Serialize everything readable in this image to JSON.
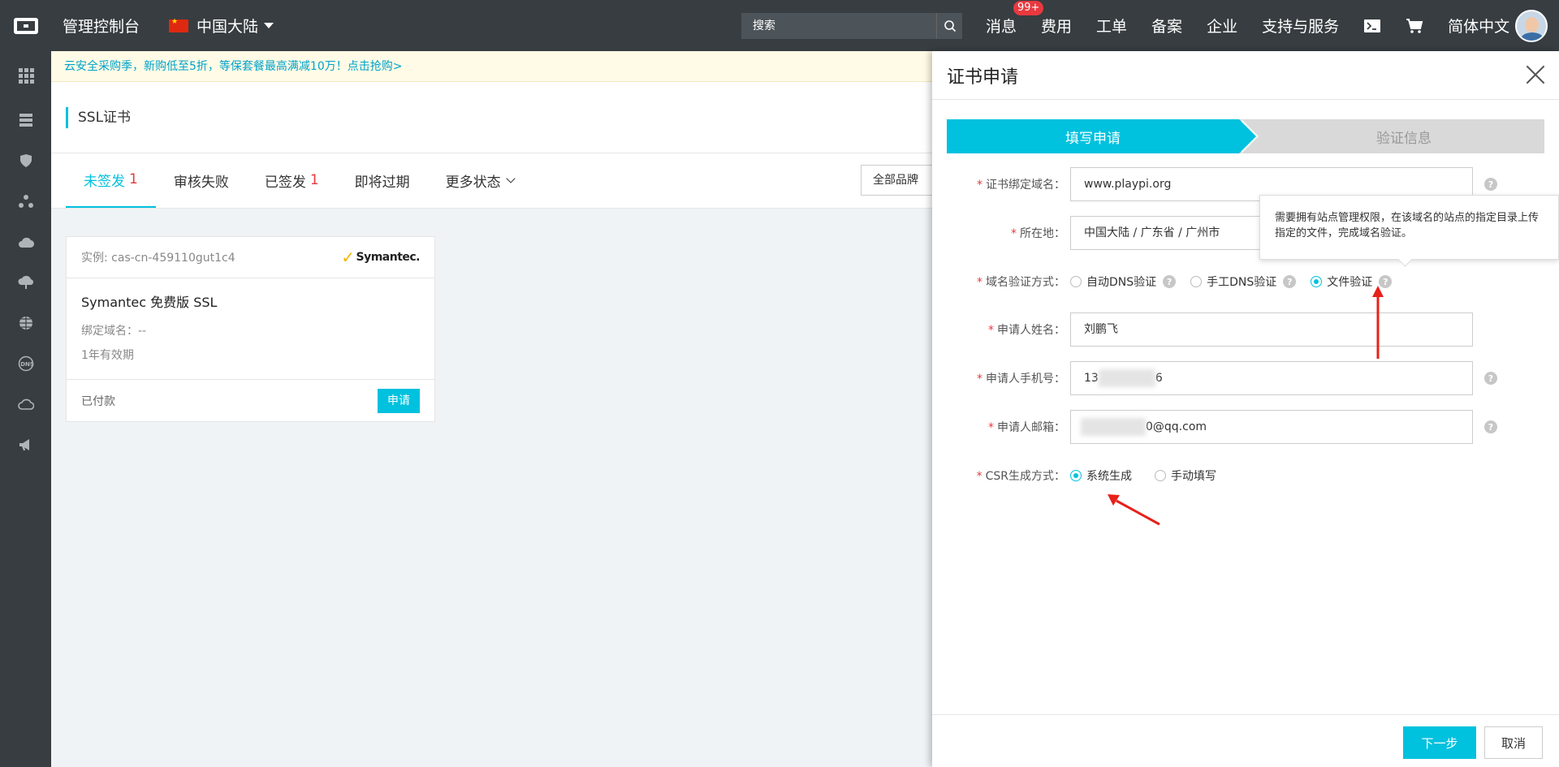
{
  "topbar": {
    "console_title": "管理控制台",
    "region": "中国大陆",
    "search_placeholder": "搜索",
    "nav": {
      "messages": "消息",
      "messages_badge": "99+",
      "billing": "费用",
      "tickets": "工单",
      "icp": "备案",
      "enterprise": "企业",
      "support": "支持与服务",
      "language": "简体中文"
    }
  },
  "promo": "云安全采购季，新购低至5折，等保套餐最高满减10万！点击抢购>",
  "page": {
    "title": "SSL证书",
    "tabs": [
      {
        "label": "未签发",
        "count": "1"
      },
      {
        "label": "审核失败",
        "count": ""
      },
      {
        "label": "已签发",
        "count": "1"
      },
      {
        "label": "即将过期",
        "count": ""
      },
      {
        "label": "更多状态",
        "count": ""
      }
    ],
    "brand_filter": "全部品牌"
  },
  "card": {
    "instance": "实例: cas-cn-459110gut1c4",
    "brand": "Symantec.",
    "name": "Symantec 免费版 SSL",
    "domain": "绑定域名：--",
    "validity": "1年有效期",
    "status": "已付款",
    "apply": "申请"
  },
  "drawer": {
    "title": "证书申请",
    "steps": [
      "填写申请",
      "验证信息"
    ],
    "fields": {
      "domain_label": "证书绑定域名：",
      "domain_value": "www.playpi.org",
      "location_label": "所在地：",
      "location_value": "中国大陆 / 广东省 / 广州市",
      "verify_label": "域名验证方式：",
      "verify_options": [
        "自动DNS验证",
        "手工DNS验证",
        "文件验证"
      ],
      "name_label": "申请人姓名：",
      "name_value": "刘鹏飞",
      "phone_label": "申请人手机号：",
      "phone_prefix": "13",
      "phone_suffix": "6",
      "email_label": "申请人邮箱：",
      "email_suffix": "0@qq.com",
      "csr_label": "CSR生成方式：",
      "csr_options": [
        "系统生成",
        "手动填写"
      ],
      "required_mark": "*",
      "help_mark": "?"
    },
    "tooltip": "需要拥有站点管理权限，在该域名的站点的指定目录上传指定的文件，完成域名验证。",
    "next": "下一步",
    "cancel": "取消"
  },
  "colors": {
    "accent": "#00c1de",
    "topbar": "#373d41",
    "annotation_arrow": "#e8201a"
  }
}
